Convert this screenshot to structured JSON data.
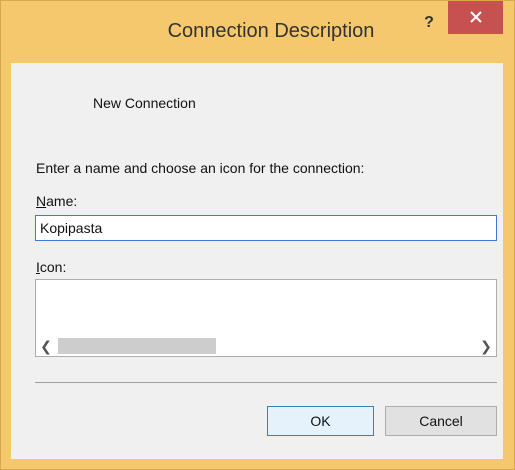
{
  "window": {
    "title": "Connection Description",
    "help_label": "?"
  },
  "connection": {
    "name": "New Connection"
  },
  "form": {
    "instructions": "Enter a name and choose an icon for the connection:",
    "name_label": "Name:",
    "name_access_key": "N",
    "name_label_rest": "ame:",
    "name_value": "Kopipasta",
    "icon_access_key": "I",
    "icon_label_rest": "con:"
  },
  "buttons": {
    "ok_label": "OK",
    "cancel_label": "Cancel"
  },
  "icons": {
    "close": "close-icon",
    "scroll_left": "chevron-left-icon",
    "scroll_right": "chevron-right-icon"
  },
  "colors": {
    "frame": "#f5c86d",
    "close": "#c75050",
    "focus_border": "#3d7bd1",
    "client": "#f0f0f0"
  }
}
